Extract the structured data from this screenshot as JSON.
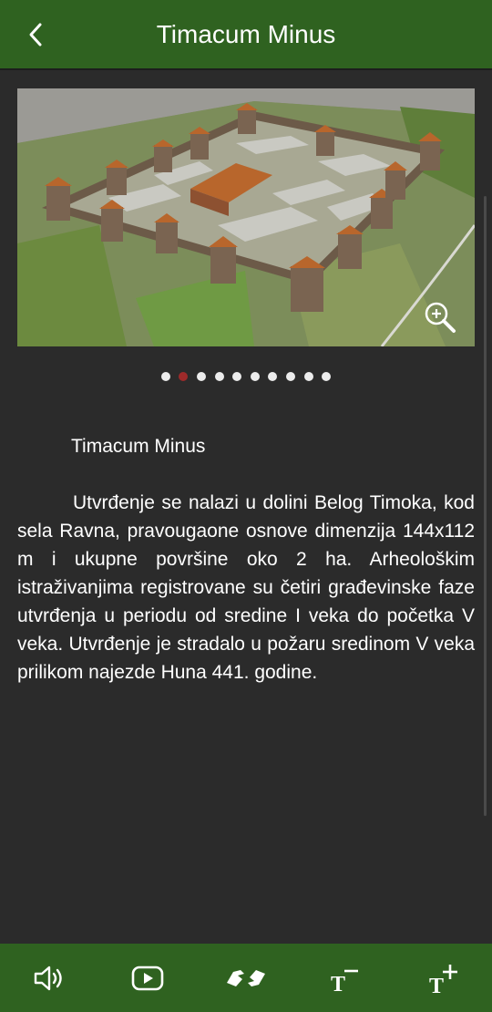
{
  "header": {
    "title": "Timacum Minus",
    "back_icon": "chevron-left-icon"
  },
  "gallery": {
    "image_alt": "Reconstruction of the Timacum Minus fortress",
    "zoom_icon": "zoom-in-icon",
    "slide_count": 10,
    "active_slide": 2
  },
  "content": {
    "heading": "Timacum Minus",
    "body": "Utvrđenje se nalazi u dolini Belog Timoka, kod sela Ravna, pravougaone osnove dimenzija 144x112 m i ukupne površine oko 2 ha. Arheološkim istraživanjima registrovane su četiri građevinske faze utvrđenja u periodu od sredine I veka do početka V veka. Utvrđenje je stradalo u požaru sredinom V veka prilikom najezde Huna 441. godine."
  },
  "toolbar": {
    "items": [
      {
        "name": "audio-button",
        "icon": "speaker-icon"
      },
      {
        "name": "video-button",
        "icon": "play-icon"
      },
      {
        "name": "sign-language-button",
        "icon": "sign-language-icon"
      },
      {
        "name": "decrease-text-button",
        "icon": "text-decrease-icon"
      },
      {
        "name": "increase-text-button",
        "icon": "text-increase-icon"
      }
    ]
  },
  "colors": {
    "bar_green": "#2f6220",
    "background": "#2b2b2b",
    "dot_active": "#9e2a2a",
    "dot_inactive": "#ececec"
  }
}
